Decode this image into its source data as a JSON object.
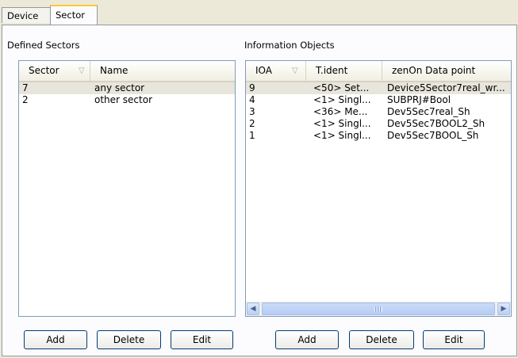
{
  "tabs": [
    {
      "label": "Device"
    },
    {
      "label": "Sector"
    }
  ],
  "left": {
    "title": "Defined Sectors",
    "columns": {
      "sector": "Sector",
      "name": "Name"
    },
    "rows": [
      {
        "sector": "7",
        "name": "any sector"
      },
      {
        "sector": "2",
        "name": "other sector"
      }
    ],
    "buttons": {
      "add": "Add",
      "delete": "Delete",
      "edit": "Edit"
    }
  },
  "right": {
    "title": "Information Objects",
    "columns": {
      "ioa": "IOA",
      "tident": "T.ident",
      "datapoint": "zenOn Data point"
    },
    "rows": [
      {
        "ioa": "9",
        "tident": "<50> Set...",
        "datapoint": "Device5Sector7real_wr..."
      },
      {
        "ioa": "4",
        "tident": "<1> Singl...",
        "datapoint": "SUBPRJ#Bool"
      },
      {
        "ioa": "3",
        "tident": "<36> Me...",
        "datapoint": "Dev5Sec7real_Sh"
      },
      {
        "ioa": "2",
        "tident": "<1> Singl...",
        "datapoint": "Dev5Sec7BOOL2_Sh"
      },
      {
        "ioa": "1",
        "tident": "<1> Singl...",
        "datapoint": "Dev5Sec7BOOL_Sh"
      }
    ],
    "buttons": {
      "add": "Add",
      "delete": "Delete",
      "edit": "Edit"
    }
  },
  "icons": {
    "sort": "sort-arrow-icon",
    "scroll_left": "scroll-left-arrow-icon",
    "scroll_right": "scroll-right-arrow-icon"
  }
}
